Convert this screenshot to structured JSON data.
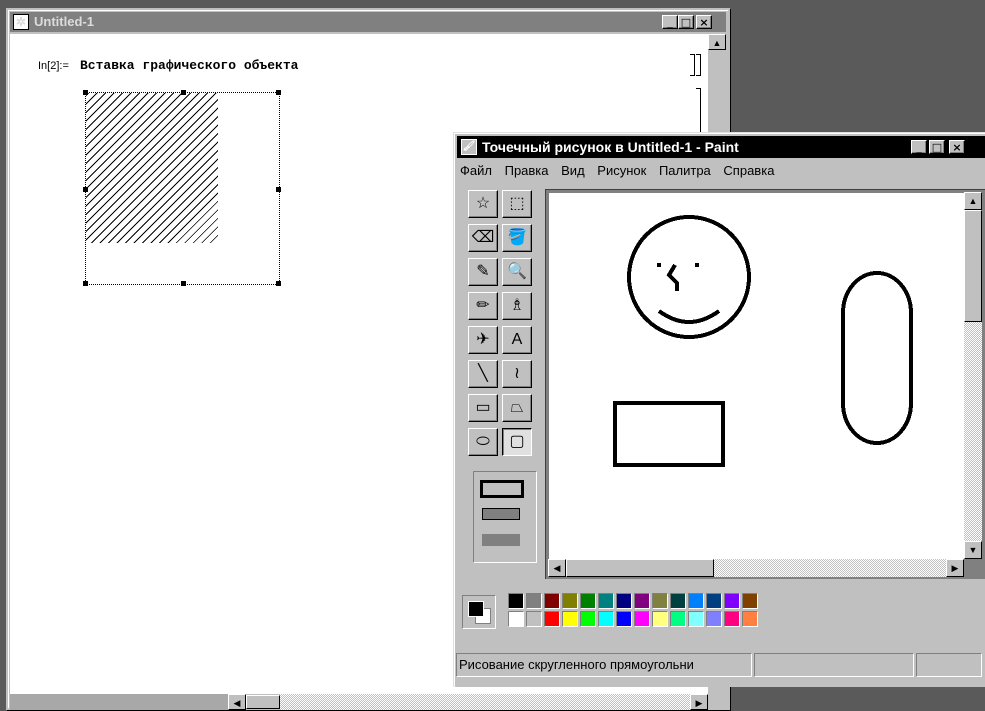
{
  "notebook": {
    "title": "Untitled-1",
    "cell_label": "In[2]:=",
    "cell_text": "Вставка графического объекта",
    "controls": {
      "minimize": "_",
      "maximize": "□",
      "close": "×"
    }
  },
  "paint": {
    "title": "Точечный рисунок в Untitled-1 - Paint",
    "controls": {
      "minimize": "_",
      "maximize": "□",
      "close": "×"
    },
    "menu": [
      "Файл",
      "Правка",
      "Вид",
      "Рисунок",
      "Палитра",
      "Справка"
    ],
    "tools": [
      {
        "name": "free-select-tool",
        "glyph": "☆"
      },
      {
        "name": "rect-select-tool",
        "glyph": "⬚"
      },
      {
        "name": "eraser-tool",
        "glyph": "⌫"
      },
      {
        "name": "fill-tool",
        "glyph": "🪣"
      },
      {
        "name": "color-picker-tool",
        "glyph": "✎"
      },
      {
        "name": "magnifier-tool",
        "glyph": "🔍"
      },
      {
        "name": "pencil-tool",
        "glyph": "✏"
      },
      {
        "name": "brush-tool",
        "glyph": "♗"
      },
      {
        "name": "airbrush-tool",
        "glyph": "✈"
      },
      {
        "name": "text-tool",
        "glyph": "A"
      },
      {
        "name": "line-tool",
        "glyph": "╲"
      },
      {
        "name": "curve-tool",
        "glyph": "≀"
      },
      {
        "name": "rectangle-tool",
        "glyph": "▭"
      },
      {
        "name": "polygon-tool",
        "glyph": "⏢"
      },
      {
        "name": "ellipse-tool",
        "glyph": "⬭"
      },
      {
        "name": "rounded-rect-tool",
        "glyph": "▢"
      }
    ],
    "selected_tool": "rounded-rect-tool",
    "palette_top": [
      "#000000",
      "#808080",
      "#800000",
      "#808000",
      "#008000",
      "#008080",
      "#000080",
      "#800080",
      "#808040",
      "#004040",
      "#0080ff",
      "#004080",
      "#8000ff",
      "#804000"
    ],
    "palette_bottom": [
      "#ffffff",
      "#c0c0c0",
      "#ff0000",
      "#ffff00",
      "#00ff00",
      "#00ffff",
      "#0000ff",
      "#ff00ff",
      "#ffff80",
      "#00ff80",
      "#80ffff",
      "#8080ff",
      "#ff0080",
      "#ff8040"
    ],
    "foreground_color": "#000000",
    "background_color": "#ffffff",
    "status_text": "Рисование скругленного прямоугольни"
  }
}
